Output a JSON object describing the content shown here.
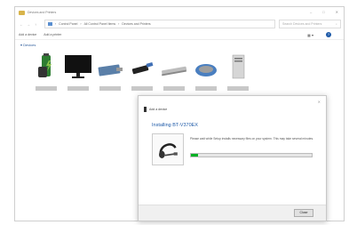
{
  "window": {
    "title": "Devices and Printers",
    "controls": [
      "–",
      "□",
      "✕"
    ]
  },
  "nav": {
    "back": "←",
    "forward": "→",
    "up": "↑"
  },
  "address": {
    "crumbs": [
      "Control Panel",
      "All Control Panel Items",
      "Devices and Printers"
    ],
    "separator": "›"
  },
  "search": {
    "placeholder": "Search Devices and Printers"
  },
  "toolbar": {
    "add_device": "Add a device",
    "add_printer": "Add a printer"
  },
  "section": {
    "label": "Devices"
  },
  "devices": [
    {
      "icon": "battery-icon"
    },
    {
      "icon": "monitor-icon"
    },
    {
      "icon": "usb-hub-icon"
    },
    {
      "icon": "usb-stick-icon"
    },
    {
      "icon": "scanner-icon"
    },
    {
      "icon": "mouse-icon"
    },
    {
      "icon": "computer-tower-icon"
    }
  ],
  "dialog": {
    "header": "Add a device",
    "title": "Installing BT-V370EX",
    "message": "Please wait while Setup installs necessary files on your system. This may take several minutes.",
    "progress": 0.06,
    "close_label": "Close"
  },
  "colors": {
    "accent": "#1e5aa8",
    "progress": "#06b025"
  }
}
